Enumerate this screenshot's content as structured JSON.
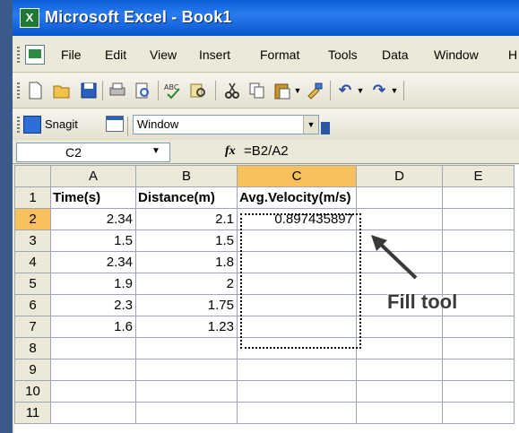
{
  "window": {
    "title": "Microsoft Excel - Book1",
    "icon": "excel-icon"
  },
  "menu": {
    "items": [
      "File",
      "Edit",
      "View",
      "Insert",
      "Format",
      "Tools",
      "Data",
      "Window",
      "H"
    ]
  },
  "toolbar": {
    "icons": [
      "new-icon",
      "open-icon",
      "save-icon",
      "print-icon",
      "print-preview-icon",
      "spelling-icon",
      "research-icon",
      "cut-icon",
      "copy-icon",
      "paste-icon",
      "format-painter-icon",
      "undo-icon",
      "redo-icon"
    ]
  },
  "snagit": {
    "label": "Snagit",
    "window_label": "Window"
  },
  "formula_bar": {
    "name_box": "C2",
    "fx": "fx",
    "formula": "=B2/A2"
  },
  "sheet": {
    "columns": [
      "A",
      "B",
      "C",
      "D",
      "E"
    ],
    "rows": [
      {
        "n": "1",
        "cells": [
          "Time(s)",
          "Distance(m)",
          "Avg.Velocity(m/s)",
          "",
          ""
        ]
      },
      {
        "n": "2",
        "cells": [
          "2.34",
          "2.1",
          "0.897435897",
          "",
          ""
        ]
      },
      {
        "n": "3",
        "cells": [
          "1.5",
          "1.5",
          "",
          "",
          ""
        ]
      },
      {
        "n": "4",
        "cells": [
          "2.34",
          "1.8",
          "",
          "",
          ""
        ]
      },
      {
        "n": "5",
        "cells": [
          "1.9",
          "2",
          "",
          "",
          ""
        ]
      },
      {
        "n": "6",
        "cells": [
          "2.3",
          "1.75",
          "",
          "",
          ""
        ]
      },
      {
        "n": "7",
        "cells": [
          "1.6",
          "1.23",
          "",
          "",
          ""
        ]
      },
      {
        "n": "8",
        "cells": [
          "",
          "",
          "",
          "",
          ""
        ]
      },
      {
        "n": "9",
        "cells": [
          "",
          "",
          "",
          "",
          ""
        ]
      },
      {
        "n": "10",
        "cells": [
          "",
          "",
          "",
          "",
          ""
        ]
      },
      {
        "n": "11",
        "cells": [
          "",
          "",
          "",
          "",
          ""
        ]
      }
    ]
  },
  "annotation": {
    "label": "Fill tool"
  }
}
